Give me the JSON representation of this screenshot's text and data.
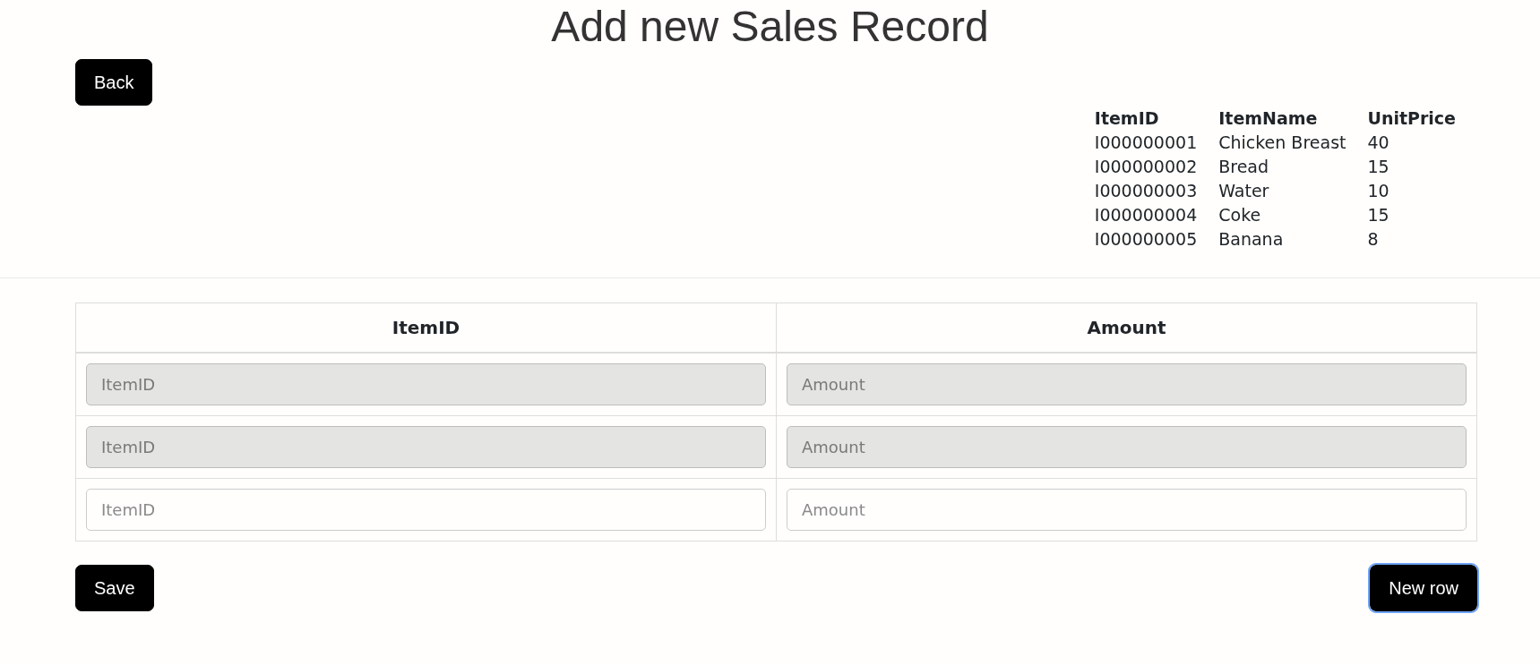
{
  "title": "Add new Sales Record",
  "back_button": "Back",
  "items_table": {
    "columns": [
      "ItemID",
      "ItemName",
      "UnitPrice"
    ],
    "rows": [
      [
        "I000000001",
        "Chicken Breast",
        "40"
      ],
      [
        "I000000002",
        "Bread",
        "15"
      ],
      [
        "I000000003",
        "Water",
        "10"
      ],
      [
        "I000000004",
        "Coke",
        "15"
      ],
      [
        "I000000005",
        "Banana",
        "8"
      ]
    ]
  },
  "sales_table": {
    "columns": [
      "ItemID",
      "Amount"
    ],
    "rows": [
      {
        "item_id": {
          "placeholder": "ItemID",
          "disabled": true
        },
        "amount": {
          "placeholder": "Amount",
          "disabled": true
        }
      },
      {
        "item_id": {
          "placeholder": "ItemID",
          "disabled": true
        },
        "amount": {
          "placeholder": "Amount",
          "disabled": true
        }
      },
      {
        "item_id": {
          "placeholder": "ItemID",
          "disabled": false
        },
        "amount": {
          "placeholder": "Amount",
          "disabled": false
        }
      }
    ]
  },
  "save_button": "Save",
  "new_row_button": {
    "label": "New row",
    "focused": true
  }
}
